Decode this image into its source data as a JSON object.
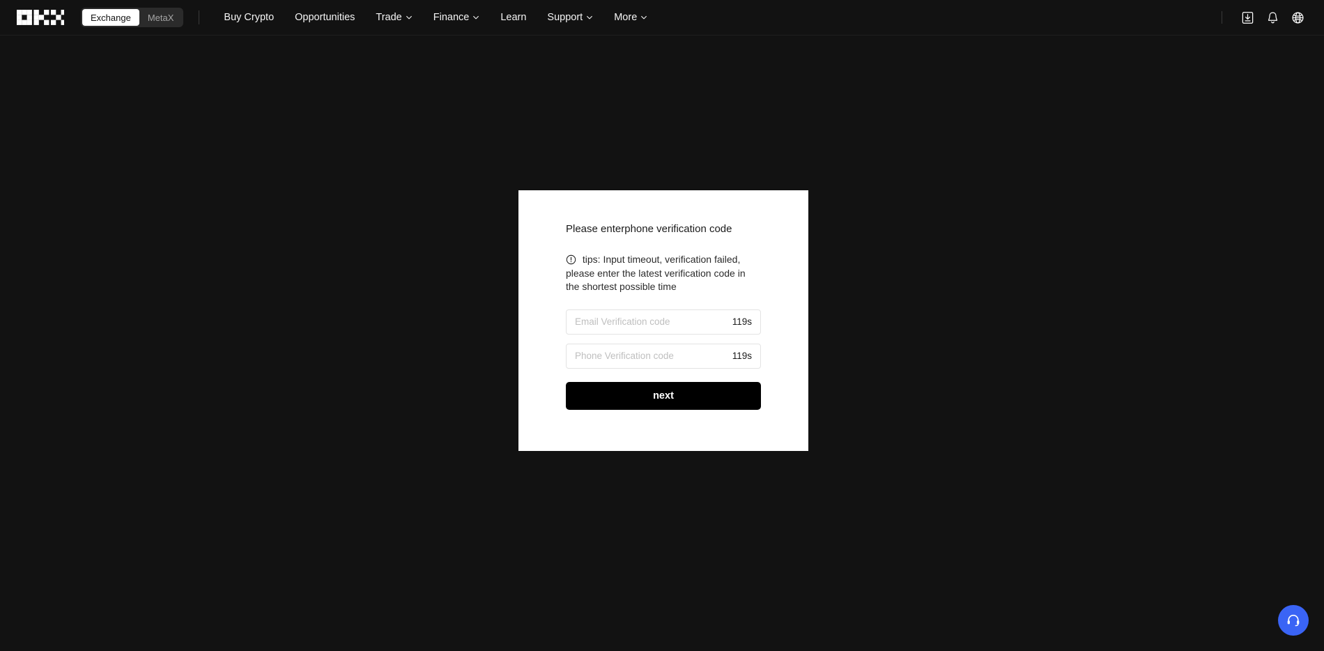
{
  "theme": {
    "page_background": "#121212",
    "card_background": "#ffffff",
    "accent_button": "#000000",
    "support_fab_color": "#3a64f5",
    "nav_text": "#f5f5f5",
    "placeholder": "#bfbfbf"
  },
  "header": {
    "logo_name": "okx-logo",
    "product_switch": {
      "tabs": [
        {
          "label": "Exchange",
          "active": true
        },
        {
          "label": "MetaX",
          "active": false
        }
      ]
    },
    "nav_items": [
      {
        "label": "Buy Crypto",
        "has_chevron": false
      },
      {
        "label": "Opportunities",
        "has_chevron": false
      },
      {
        "label": "Trade",
        "has_chevron": true
      },
      {
        "label": "Finance",
        "has_chevron": true
      },
      {
        "label": "Learn",
        "has_chevron": false
      },
      {
        "label": "Support",
        "has_chevron": true
      },
      {
        "label": "More",
        "has_chevron": true
      }
    ],
    "right_icons": [
      {
        "name": "download-icon"
      },
      {
        "name": "notifications-bell-icon"
      },
      {
        "name": "language-globe-icon"
      }
    ]
  },
  "modal": {
    "title": "Please enterphone verification code",
    "tips_icon": "exclamation-circle-icon",
    "tips_text": "tips: Input timeout, verification failed, please enter the latest verification code in the shortest possible time",
    "fields": [
      {
        "name": "email-verification-code",
        "placeholder": "Email Verification code",
        "value": "",
        "countdown": "119s"
      },
      {
        "name": "phone-verification-code",
        "placeholder": "Phone Verification code",
        "value": "",
        "countdown": "119s"
      }
    ],
    "submit_label": "next"
  },
  "support": {
    "icon": "headset-icon",
    "label": "Customer support"
  }
}
